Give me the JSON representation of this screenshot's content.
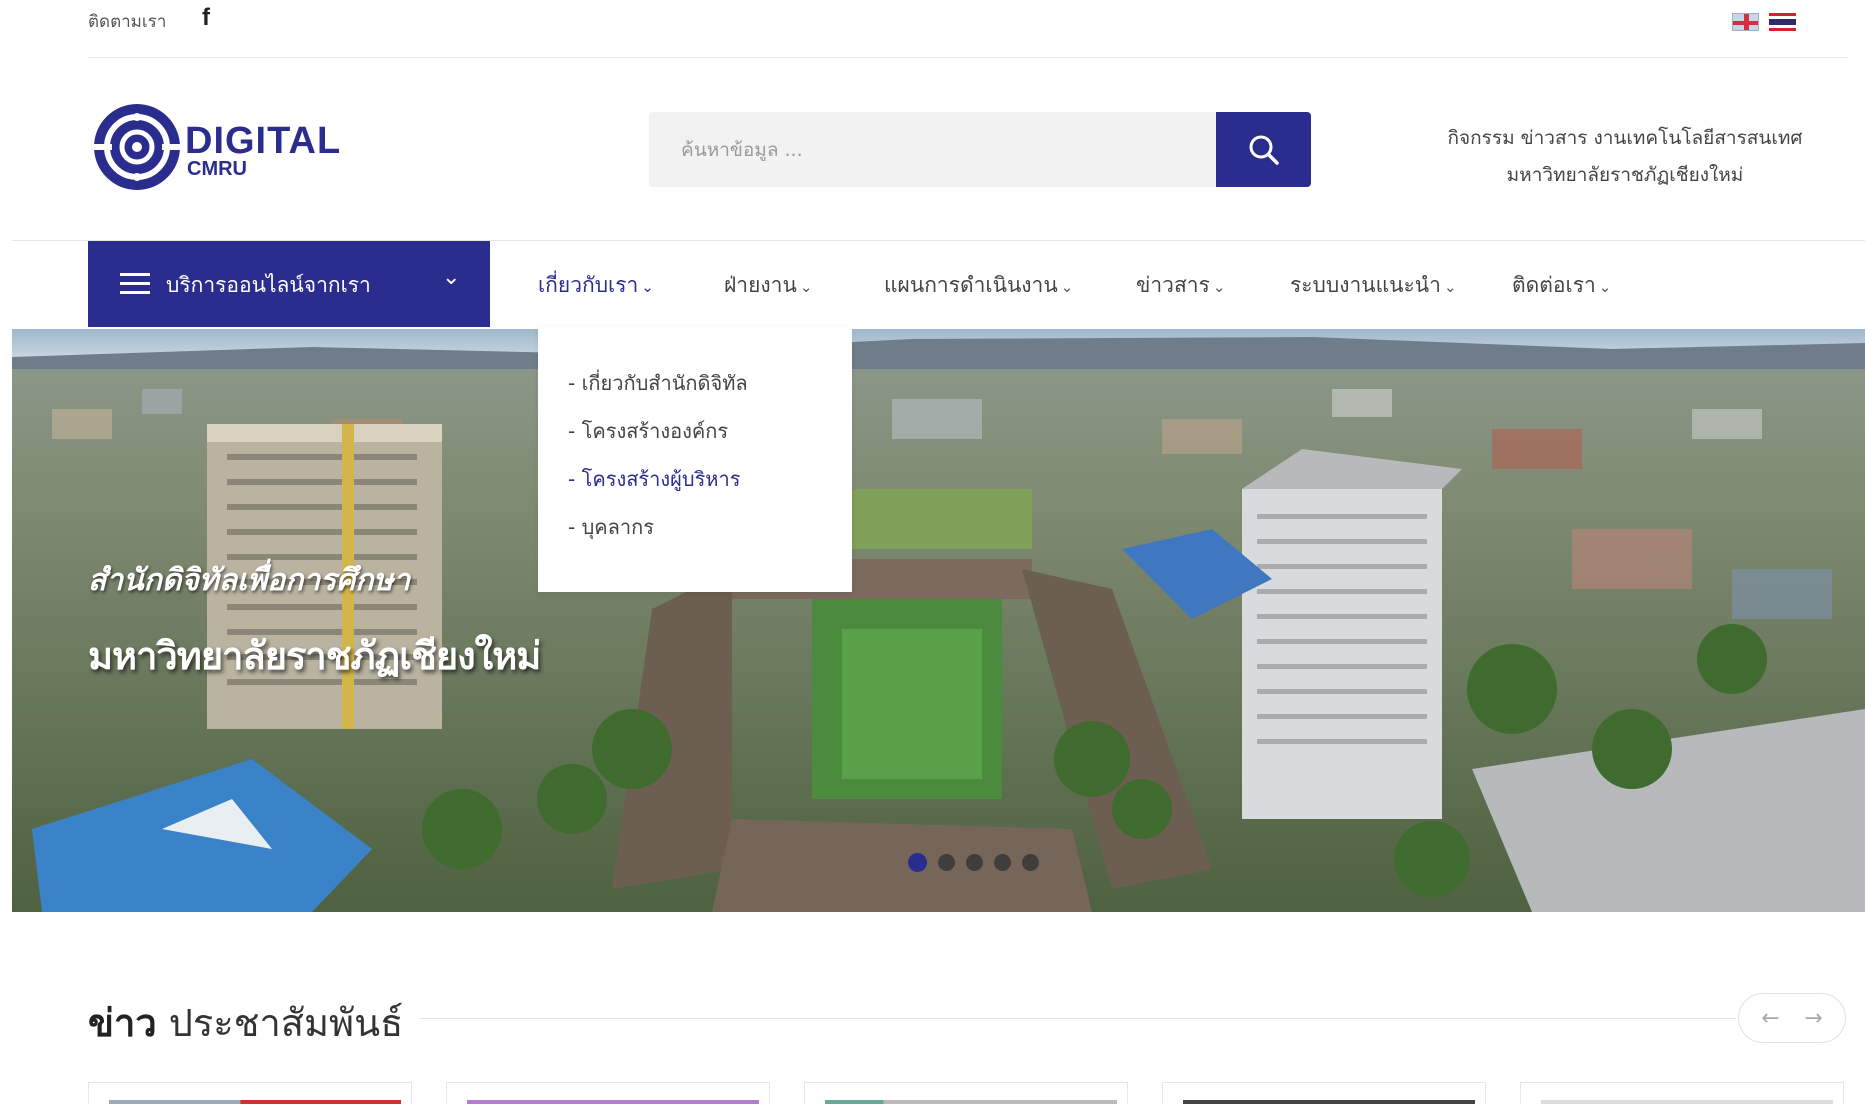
{
  "topbar": {
    "follow_label": "ติดตามเรา",
    "facebook_icon": "f",
    "flags": [
      "english-flag-icon",
      "thai-flag-icon"
    ]
  },
  "logo": {
    "wordmark": "DIGITAL",
    "sub_wordmark": "CMRU"
  },
  "search": {
    "placeholder": "ค้นหาข้อมูล ...",
    "button_icon": "search-icon"
  },
  "tagline": {
    "line1": "กิจกรรม ข่าวสาร งานเทคโนโลยีสารสนเทศ",
    "line2": "มหาวิทยาลัยราชภัฏเชียงใหม่"
  },
  "services_menu": {
    "label": "บริการออนไลน์จากเรา",
    "chevron": "⌄"
  },
  "nav": {
    "items": [
      {
        "label": "เกี่ยวกับเรา",
        "active": true
      },
      {
        "label": "ฝ่ายงาน"
      },
      {
        "label": "แผนการดำเนินงาน"
      },
      {
        "label": "ข่าวสาร"
      },
      {
        "label": "ระบบงานแนะนำ"
      },
      {
        "label": "ติดต่อเรา"
      }
    ],
    "caret": "⌄"
  },
  "dropdown": {
    "items": [
      {
        "label": "- เกี่ยวกับสำนักดิจิทัล"
      },
      {
        "label": "- โครงสร้างองค์กร"
      },
      {
        "label": "- โครงสร้างผู้บริหาร",
        "active": true
      },
      {
        "label": "- บุคลากร"
      }
    ]
  },
  "hero": {
    "caption1": "สำนักดิจิทัลเพื่อการศึกษา",
    "caption2": "มหาวิทยาลัยราชภัฏเชียงใหม่",
    "slide_count": 5,
    "active_slide": 1
  },
  "news": {
    "title_bold": "ข่าว",
    "title_rest": " ประชาสัมพันธ์",
    "prev_arrow": "←",
    "next_arrow": "→"
  },
  "colors": {
    "brand": "#2b2d8e",
    "text": "#444444"
  }
}
